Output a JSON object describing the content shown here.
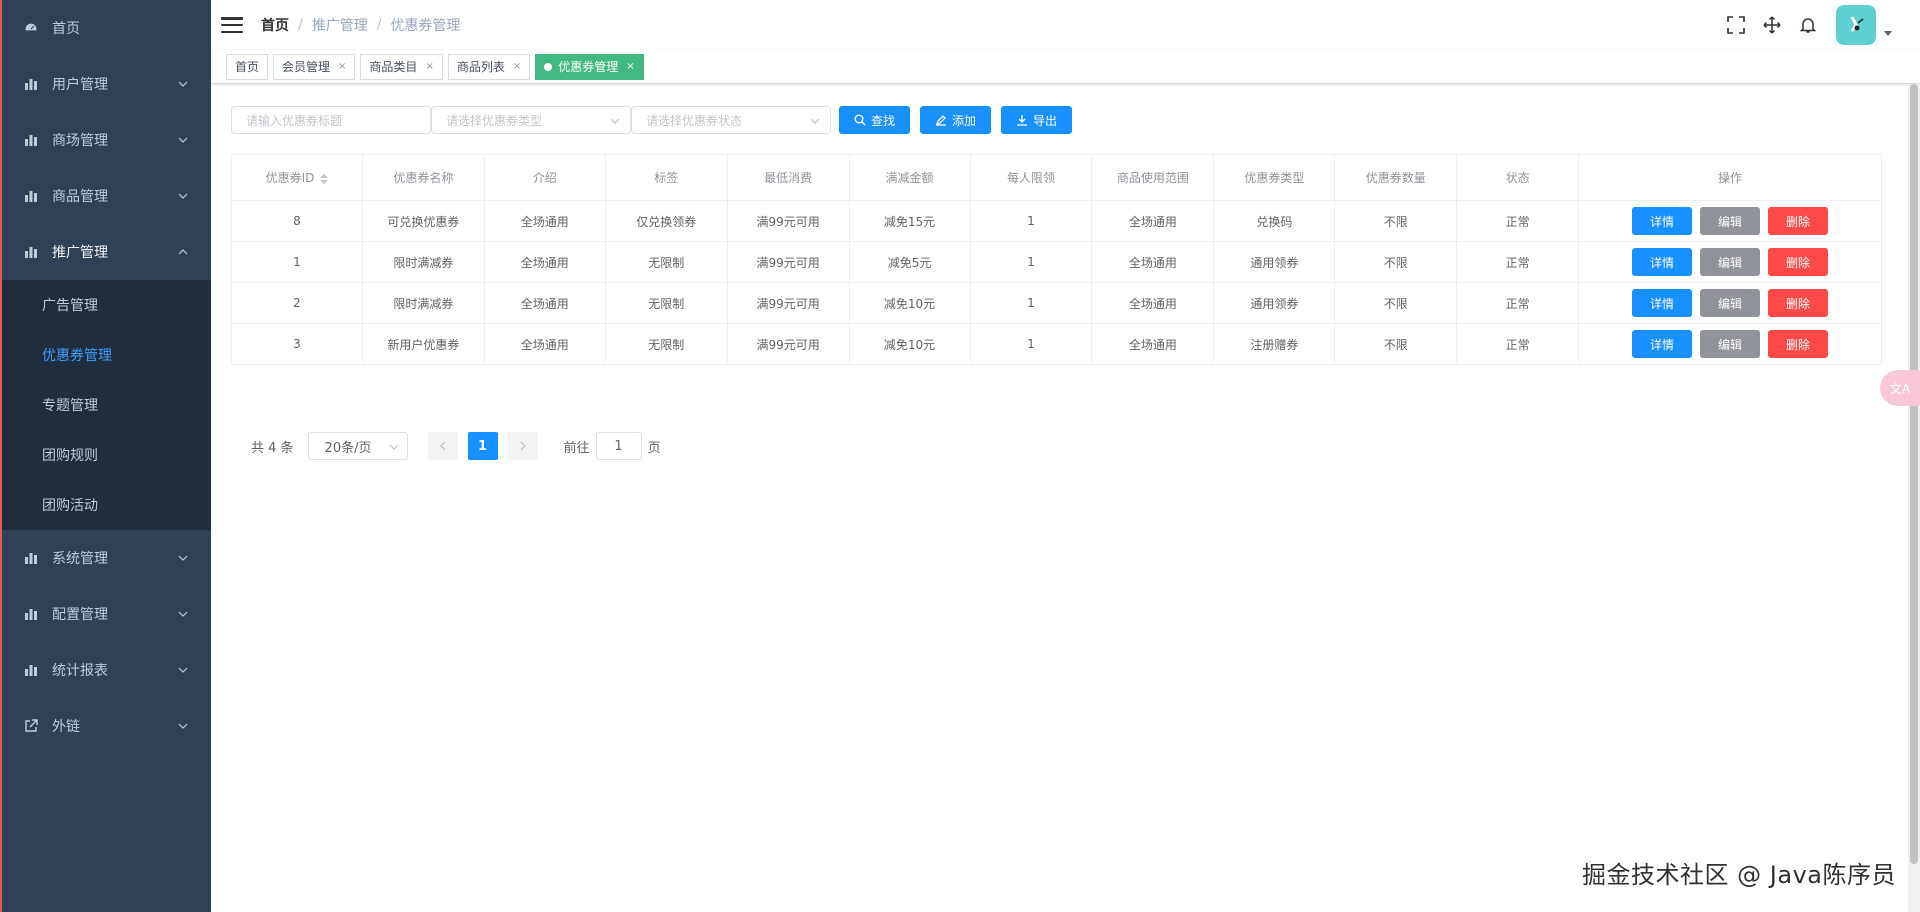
{
  "sidebar": {
    "items": [
      {
        "label": "首页",
        "icon": "dashboard-icon",
        "expandable": false
      },
      {
        "label": "用户管理",
        "icon": "bar-chart-icon",
        "expandable": true
      },
      {
        "label": "商场管理",
        "icon": "bar-chart-icon",
        "expandable": true
      },
      {
        "label": "商品管理",
        "icon": "bar-chart-icon",
        "expandable": true
      },
      {
        "label": "推广管理",
        "icon": "bar-chart-icon",
        "expandable": true,
        "expanded": true
      },
      {
        "label": "系统管理",
        "icon": "bar-chart-icon",
        "expandable": true
      },
      {
        "label": "配置管理",
        "icon": "bar-chart-icon",
        "expandable": true
      },
      {
        "label": "统计报表",
        "icon": "bar-chart-icon",
        "expandable": true
      },
      {
        "label": "外链",
        "icon": "external-link-icon",
        "expandable": true
      }
    ],
    "submenu": [
      {
        "label": "广告管理",
        "active": false
      },
      {
        "label": "优惠券管理",
        "active": true
      },
      {
        "label": "专题管理",
        "active": false
      },
      {
        "label": "团购规则",
        "active": false
      },
      {
        "label": "团购活动",
        "active": false
      }
    ]
  },
  "header": {
    "breadcrumb": [
      "首页",
      "推广管理",
      "优惠券管理"
    ],
    "breadcrumb_sep": "/"
  },
  "tags": [
    {
      "label": "首页",
      "closable": false,
      "active": false
    },
    {
      "label": "会员管理",
      "closable": true,
      "active": false
    },
    {
      "label": "商品类目",
      "closable": true,
      "active": false
    },
    {
      "label": "商品列表",
      "closable": true,
      "active": false
    },
    {
      "label": "优惠券管理",
      "closable": true,
      "active": true
    }
  ],
  "tag_close": "×",
  "filters": {
    "title_placeholder": "请输入优惠券标题",
    "type_placeholder": "请选择优惠券类型",
    "status_placeholder": "请选择优惠券状态",
    "search_label": "查找",
    "add_label": "添加",
    "export_label": "导出"
  },
  "table": {
    "columns": [
      "优惠券ID",
      "优惠券名称",
      "介绍",
      "标签",
      "最低消费",
      "满减金额",
      "每人限领",
      "商品使用范围",
      "优惠券类型",
      "优惠券数量",
      "状态",
      "操作"
    ],
    "rows": [
      [
        "8",
        "可兑换优惠券",
        "全场通用",
        "仅兑换领券",
        "满99元可用",
        "减免15元",
        "1",
        "全场通用",
        "兑换码",
        "不限",
        "正常"
      ],
      [
        "1",
        "限时满减券",
        "全场通用",
        "无限制",
        "满99元可用",
        "减免5元",
        "1",
        "全场通用",
        "通用领券",
        "不限",
        "正常"
      ],
      [
        "2",
        "限时满减券",
        "全场通用",
        "无限制",
        "满99元可用",
        "减免10元",
        "1",
        "全场通用",
        "通用领券",
        "不限",
        "正常"
      ],
      [
        "3",
        "新用户优惠券",
        "全场通用",
        "无限制",
        "满99元可用",
        "减免10元",
        "1",
        "全场通用",
        "注册赠券",
        "不限",
        "正常"
      ]
    ],
    "actions": {
      "detail": "详情",
      "edit": "编辑",
      "delete": "删除"
    }
  },
  "pagination": {
    "total_text": "共 4 条",
    "page_size": "20条/页",
    "current_page": "1",
    "goto_prefix": "前往",
    "goto_value": "1",
    "goto_suffix": "页"
  },
  "translate_label": "文A",
  "watermark": "掘金技术社区 @ Java陈序员",
  "colors": {
    "sidebar_bg": "#304156",
    "submenu_bg": "#1f2d3d",
    "primary": "#1890ff",
    "active_tag": "#42b983",
    "danger": "#ff4949",
    "info": "#909399"
  }
}
